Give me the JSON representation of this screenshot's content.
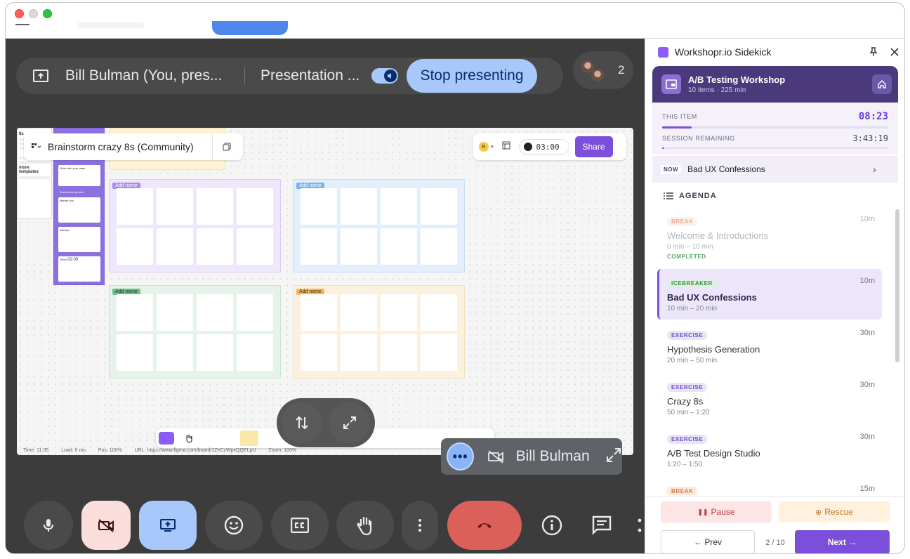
{
  "presenting_bar": {
    "presenter_name": "Bill Bulman (You, pres...",
    "presentation_label": "Presentation ...",
    "stop_button": "Stop presenting"
  },
  "participants": {
    "count": "2"
  },
  "shared_screen": {
    "file_title": "Brainstorm crazy 8s (Community)",
    "user_initial": "B",
    "timer": "03:00",
    "share_label": "Share",
    "board_tag": "Add name",
    "doc_heading": "8s",
    "doc_more": "more templates",
    "template_labels": [
      "Work with your team",
      "Brainstorming tools",
      "Marker tool",
      "Stamps",
      "Timer"
    ],
    "template_timer": "02:00",
    "status": {
      "time": "Time: 11:35",
      "load": "Load: 0 ms",
      "pos": "Pos: 100%",
      "url": "URL: https://www.figma.com/board/1ZeCzWpxQQELpU",
      "zoom": "Zoom: 100%"
    }
  },
  "self_tile": {
    "name": "Bill Bulman"
  },
  "sidekick": {
    "title": "Workshopr.io Sidekick",
    "workshop": {
      "name": "A/B Testing Workshop",
      "meta": "10 items · 225 min"
    },
    "this_item_label": "THIS ITEM",
    "this_item_time": "08:23",
    "this_item_progress": 0.13,
    "session_label": "SESSION REMAINING",
    "session_time": "3:43:19",
    "session_progress": 0.01,
    "now_badge": "NOW",
    "now_title": "Bad UX Confessions",
    "agenda_label": "AGENDA",
    "agenda": [
      {
        "type": "BREAK",
        "title": "Welcome & Introductions",
        "range": "0 min – 10 min",
        "duration": "10m",
        "status": "COMPLETED"
      },
      {
        "type": "ICEBREAKER",
        "title": "Bad UX Confessions",
        "range": "10 min – 20 min",
        "duration": "10m",
        "status": ""
      },
      {
        "type": "EXERCISE",
        "title": "Hypothesis Generation",
        "range": "20 min – 50 min",
        "duration": "30m",
        "status": ""
      },
      {
        "type": "EXERCISE",
        "title": "Crazy 8s",
        "range": "50 min – 1:20",
        "duration": "30m",
        "status": ""
      },
      {
        "type": "EXERCISE",
        "title": "A/B Test Design Studio",
        "range": "1:20 – 1:50",
        "duration": "30m",
        "status": ""
      },
      {
        "type": "BREAK",
        "title": "",
        "range": "",
        "duration": "15m",
        "status": ""
      }
    ],
    "pause_label": "Pause",
    "rescue_label": "Rescue",
    "prev_label": "← Prev",
    "page_indicator": "2 / 10",
    "next_label": "Next →"
  }
}
